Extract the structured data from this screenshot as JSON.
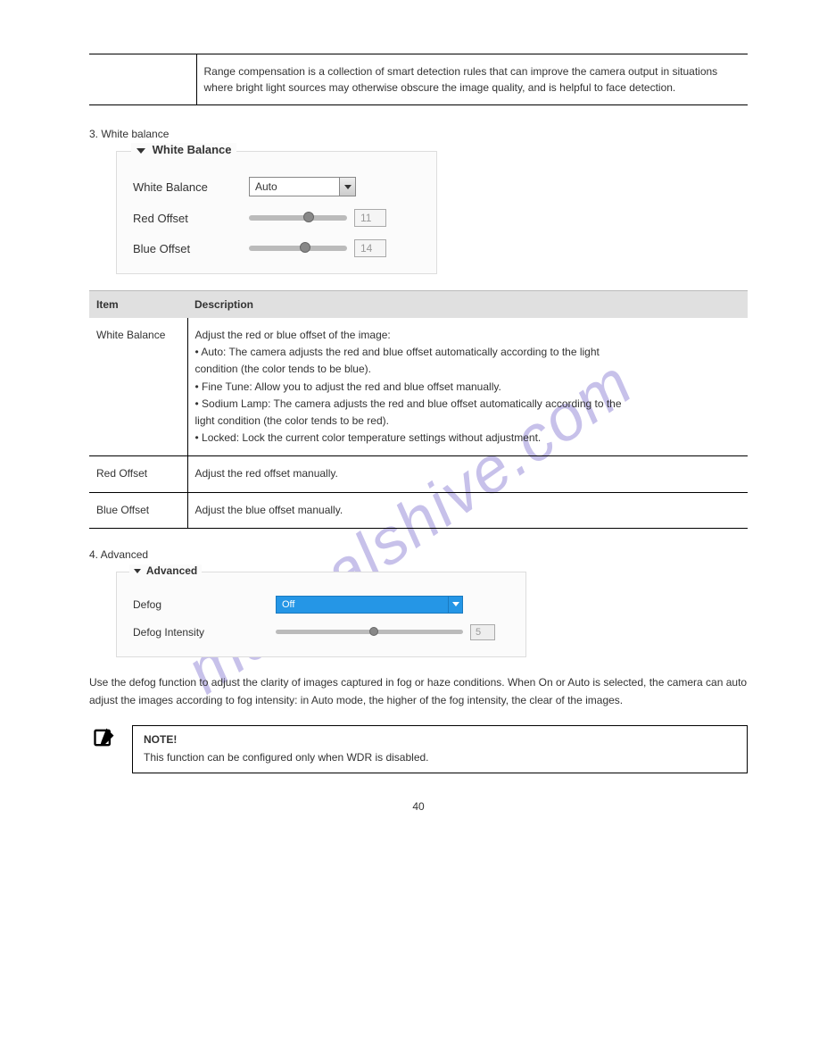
{
  "watermark": "manualshive.com",
  "top_table": {
    "c1": "",
    "c2_line1": "Range compensation is a collection of smart detection rules that can improve the camera output in",
    "c2_line2": "situations where bright light sources may otherwise obscure the image quality, and is helpful to",
    "c2_line3": "face detection."
  },
  "wb_heading": "3. White balance",
  "wb_panel": {
    "legend": "White Balance",
    "rows": {
      "mode": {
        "label": "White Balance",
        "value": "Auto"
      },
      "red": {
        "label": "Red Offset",
        "value": "11",
        "thumb_pct": 55
      },
      "blue": {
        "label": "Blue Offset",
        "value": "14",
        "thumb_pct": 52
      }
    }
  },
  "mid_table": {
    "header": {
      "c1": "Item",
      "c2": "Description"
    },
    "rows": [
      {
        "c1": "White Balance",
        "c2_lines": [
          "Adjust the red or blue offset of the image:",
          "• Auto: The camera adjusts the red and blue offset automatically according to the light",
          "condition (the color tends to be blue).",
          "• Fine Tune: Allow you to adjust the red and blue offset manually.",
          "• Sodium Lamp: The camera adjusts the red and blue offset automatically according to the",
          "light condition (the color tends to be red).",
          "• Locked: Lock the current color temperature settings without adjustment."
        ]
      },
      {
        "c1": "Red Offset",
        "c2_lines": [
          "Adjust the red offset manually."
        ]
      },
      {
        "c1": "Blue Offset",
        "c2_lines": [
          "Adjust the blue offset manually."
        ]
      }
    ]
  },
  "adv_heading": "4. Advanced",
  "adv_panel": {
    "legend": "Advanced",
    "defog": {
      "label": "Defog",
      "value": "Off"
    },
    "defog_intensity": {
      "label": "Defog Intensity",
      "value": "5",
      "thumb_pct": 50
    }
  },
  "adv_para": "Use the defog function to adjust the clarity of images captured in fog or haze conditions. When On or Auto is selected, the camera can auto adjust the images according to fog intensity: in Auto mode, the higher of the fog intensity, the clear of the images.",
  "note": {
    "label": "NOTE!",
    "text": "This function can be configured only when WDR is disabled."
  },
  "page_num": "40"
}
